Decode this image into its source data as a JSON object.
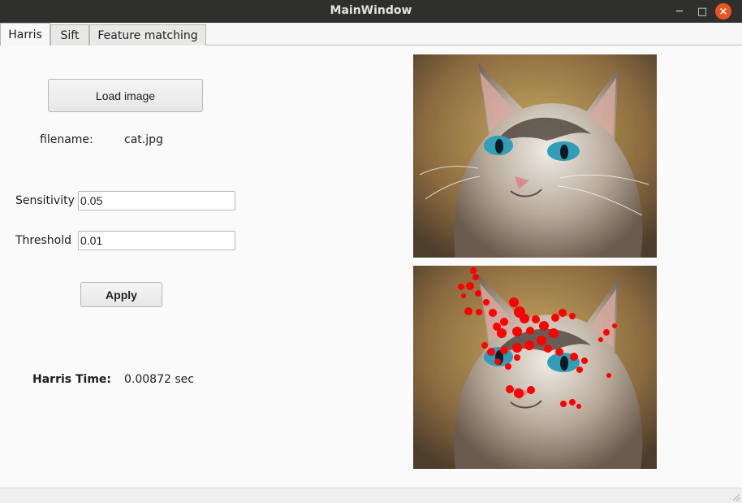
{
  "window": {
    "title": "MainWindow"
  },
  "tabs": [
    {
      "label": "Harris",
      "active": true
    },
    {
      "label": "Sift",
      "active": false
    },
    {
      "label": "Feature matching",
      "active": false
    }
  ],
  "harris": {
    "load_button": "Load image",
    "filename_label": "filename:",
    "filename_value": "cat.jpg",
    "sensitivity_label": "Sensitivity",
    "sensitivity_value": "0.05",
    "threshold_label": "Threshold",
    "threshold_value": "0.01",
    "apply_button": "Apply",
    "time_label": "Harris Time:",
    "time_value": "0.00872 sec"
  },
  "images": {
    "original": "cat-photo",
    "result": "cat-photo-with-red-harris-corners"
  },
  "colors": {
    "titlebar": "#2f2f2d",
    "close_button": "#e95420",
    "corner_points": "#ff0000"
  }
}
